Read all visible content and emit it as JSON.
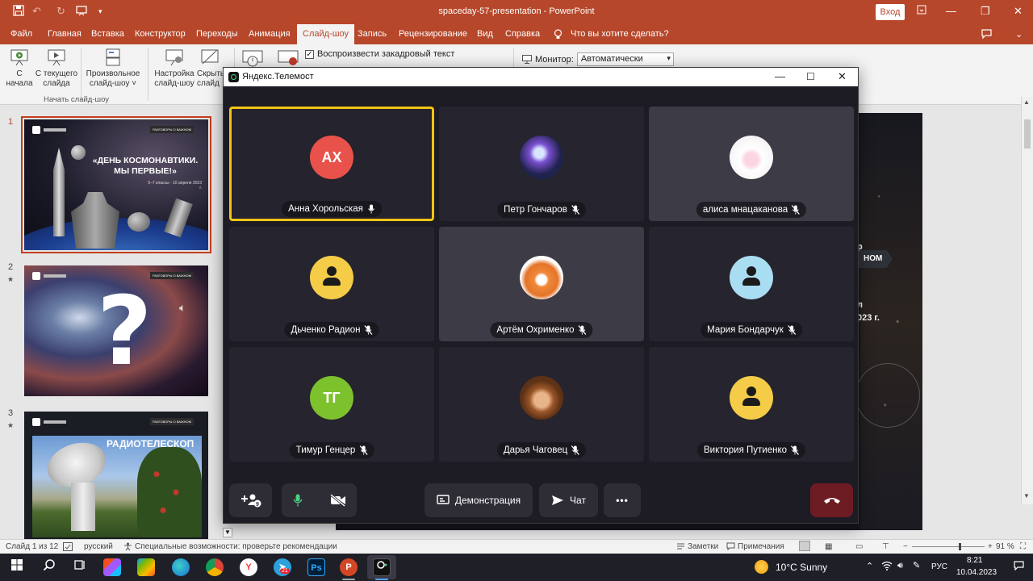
{
  "powerpoint": {
    "window_title": "spaceday-57-presentation - PowerPoint",
    "signin_label": "Вход",
    "tabs": [
      "Файл",
      "Главная",
      "Вставка",
      "Конструктор",
      "Переходы",
      "Анимация",
      "Слайд-шоу",
      "Запись",
      "Рецензирование",
      "Вид",
      "Справка"
    ],
    "active_tab": "Слайд-шоу",
    "tell_me": "Что вы хотите сделать?",
    "ribbon": {
      "from_start": [
        "С",
        "начала"
      ],
      "from_current": [
        "С текущего",
        "слайда"
      ],
      "custom_show": [
        "Произвольное",
        "слайд-шоу ˅"
      ],
      "setup_show": [
        "Настройка",
        "слайд-шоу"
      ],
      "hide_slide": [
        "Скрыть",
        "слайд"
      ],
      "group_start": "Начать слайд-шоу",
      "play_narration": "Воспроизвести закадровый текст",
      "monitor_label": "Монитор:",
      "monitor_value": "Автоматически"
    },
    "slides": [
      {
        "number": "1",
        "headline": "«ДЕНЬ КОСМОНАВТИКИ. МЫ ПЕРВЫЕ!»",
        "sub": "5–7 классы · 10 апреля 2023 г.",
        "tag": "РАЗГОВОРЫ О ВАЖНОМ"
      },
      {
        "number": "2",
        "glyph": "?",
        "tag": "РАЗГОВОРЫ О ВАЖНОМ"
      },
      {
        "number": "3",
        "headline": "РАДИОТЕЛЕСКОП",
        "tag": "РАЗГОВОРЫ О ВАЖНОМ"
      }
    ],
    "main_slide": {
      "tag": "НОМ",
      "text1": "р",
      "text2": "л",
      "text3": "023 г."
    },
    "statusbar": {
      "slide_counter": "Слайд 1 из 12",
      "language": "русский",
      "accessibility": "Специальные возможности: проверьте рекомендации",
      "notes": "Заметки",
      "comments": "Примечания",
      "zoom": "91 %"
    }
  },
  "telemost": {
    "title": "Яндекс.Телемост",
    "participants": [
      {
        "name": "Анна Хорольская",
        "initials": "АХ",
        "avatar_color": "#e8524a",
        "mic": "on",
        "speaking": true
      },
      {
        "name": "Петр Гончаров",
        "initials": "",
        "avatar_color": "#3a3f8a",
        "mic": "off"
      },
      {
        "name": "алиса мнацаканова",
        "initials": "",
        "avatar_color": "#f1eef2",
        "mic": "off"
      },
      {
        "name": "Дьченко Радион",
        "initials": "",
        "avatar_color": "#f4cc47",
        "mic": "off"
      },
      {
        "name": "Артём Охрименко",
        "initials": "",
        "avatar_color": "#ffffff",
        "mic": "off"
      },
      {
        "name": "Мария Бондарчук",
        "initials": "",
        "avatar_color": "#a9def2",
        "mic": "off"
      },
      {
        "name": "Тимур Генцер",
        "initials": "ТГ",
        "avatar_color": "#7dc12d",
        "mic": "off"
      },
      {
        "name": "Дарья Чаговец",
        "initials": "",
        "avatar_color": "#6b3c1c",
        "mic": "off"
      },
      {
        "name": "Виктория Путиенко",
        "initials": "",
        "avatar_color": "#f4cc47",
        "mic": "off"
      }
    ],
    "controls": {
      "participants_badge": "9",
      "share_label": "Демонстрация",
      "chat_label": "Чат",
      "more_label": "•••"
    }
  },
  "taskbar": {
    "weather": "10°C  Sunny",
    "language": "РУС",
    "time": "8:21",
    "date": "10.04.2023",
    "yandex_badge": "21"
  }
}
